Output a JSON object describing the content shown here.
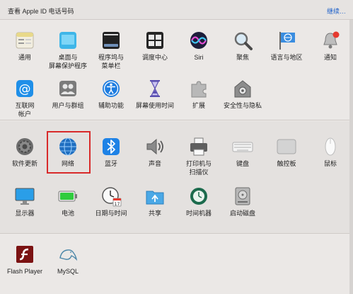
{
  "banner": {
    "text": "查看 Apple ID 电话号码",
    "link": "继续…"
  },
  "section1": {
    "row1": [
      {
        "label": "通用",
        "icon": "general-icon"
      },
      {
        "label": "桌面与\n屏幕保护程序",
        "icon": "desktop-screensaver-icon"
      },
      {
        "label": "程序坞与\n菜单栏",
        "icon": "dock-menubar-icon"
      },
      {
        "label": "调度中心",
        "icon": "mission-control-icon"
      },
      {
        "label": "Siri",
        "icon": "siri-icon"
      },
      {
        "label": "聚焦",
        "icon": "spotlight-icon"
      },
      {
        "label": "语言与地区",
        "icon": "language-region-icon"
      },
      {
        "label": "通知",
        "icon": "notifications-icon"
      }
    ],
    "row2": [
      {
        "label": "互联网\n帐户",
        "icon": "internet-accounts-icon"
      },
      {
        "label": "用户与群组",
        "icon": "users-groups-icon"
      },
      {
        "label": "辅助功能",
        "icon": "accessibility-icon"
      },
      {
        "label": "屏幕使用时间",
        "icon": "screen-time-icon"
      },
      {
        "label": "扩展",
        "icon": "extensions-icon"
      },
      {
        "label": "安全性与隐私",
        "icon": "security-privacy-icon"
      }
    ]
  },
  "section2": {
    "row1": [
      {
        "label": "软件更新",
        "icon": "software-update-icon"
      },
      {
        "label": "网络",
        "icon": "network-icon"
      },
      {
        "label": "蓝牙",
        "icon": "bluetooth-icon"
      },
      {
        "label": "声音",
        "icon": "sound-icon"
      },
      {
        "label": "打印机与\n扫描仪",
        "icon": "printers-scanners-icon"
      },
      {
        "label": "键盘",
        "icon": "keyboard-icon"
      },
      {
        "label": "触控板",
        "icon": "trackpad-icon"
      },
      {
        "label": "鼠标",
        "icon": "mouse-icon"
      }
    ],
    "row2": [
      {
        "label": "显示器",
        "icon": "displays-icon"
      },
      {
        "label": "电池",
        "icon": "battery-icon"
      },
      {
        "label": "日期与时间",
        "icon": "date-time-icon"
      },
      {
        "label": "共享",
        "icon": "sharing-icon"
      },
      {
        "label": "时间机器",
        "icon": "time-machine-icon"
      },
      {
        "label": "启动磁盘",
        "icon": "startup-disk-icon"
      }
    ]
  },
  "section3": {
    "row1": [
      {
        "label": "Flash Player",
        "icon": "flash-player-icon"
      },
      {
        "label": "MySQL",
        "icon": "mysql-icon"
      }
    ]
  },
  "colors": {
    "highlight": "#d82a2a",
    "link": "#1a5ec9"
  }
}
